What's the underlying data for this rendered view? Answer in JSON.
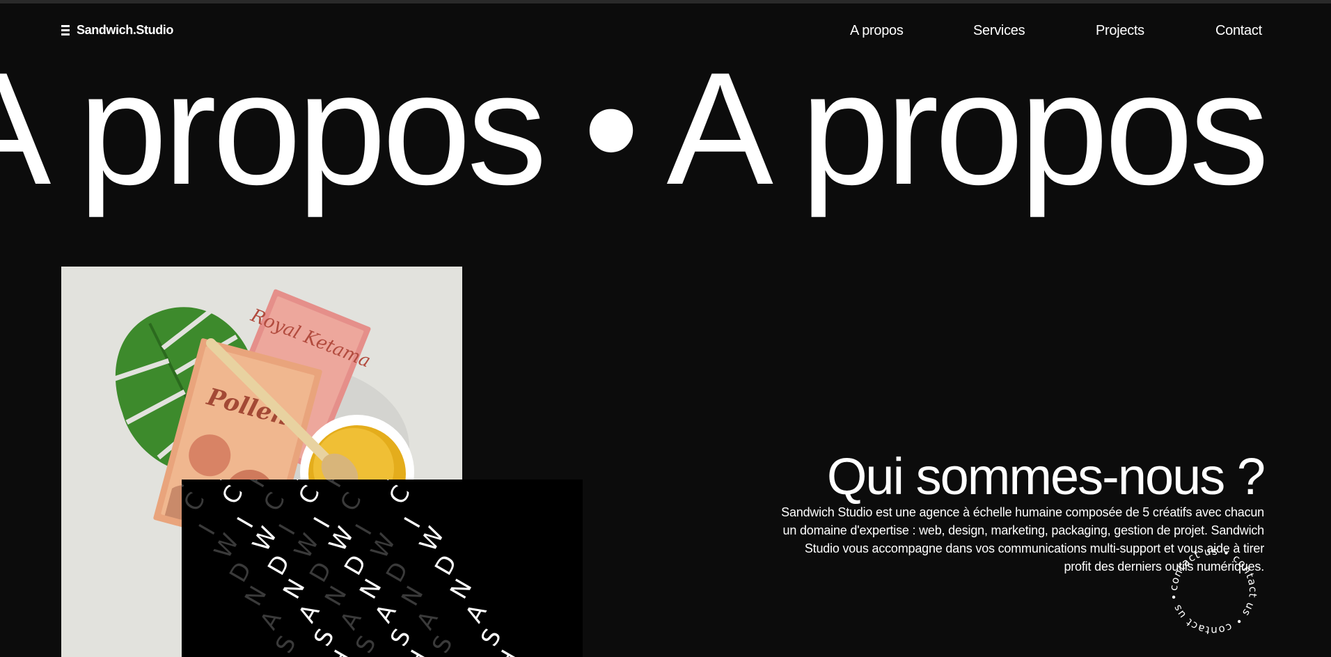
{
  "header": {
    "logo": "Sandwich.Studio",
    "nav": [
      {
        "label": "A propos"
      },
      {
        "label": "Services"
      },
      {
        "label": "Projects"
      },
      {
        "label": "Contact"
      }
    ]
  },
  "hero": {
    "marquee": "A propos • A propos"
  },
  "about": {
    "title": "Qui sommes-nous ?",
    "body": "Sandwich Studio est une agence à échelle humaine composée de 5 créatifs avec chacun un domaine d'expertise : web, design, marketing, packaging, gestion de projet. Sandwich Studio vous accompagne dans vos communications multi-support et vous aide à tirer profit des derniers outils numériques."
  },
  "image": {
    "book1_title": "Pollen",
    "book2_title": "Royal Ketama",
    "pattern_text": "SANDWICH"
  },
  "badge": {
    "circular_text": "contact us • contact us • contact us • "
  },
  "colors": {
    "background": "#0c0c0c",
    "text": "#ffffff",
    "photo_bg": "#e2e2dd"
  }
}
